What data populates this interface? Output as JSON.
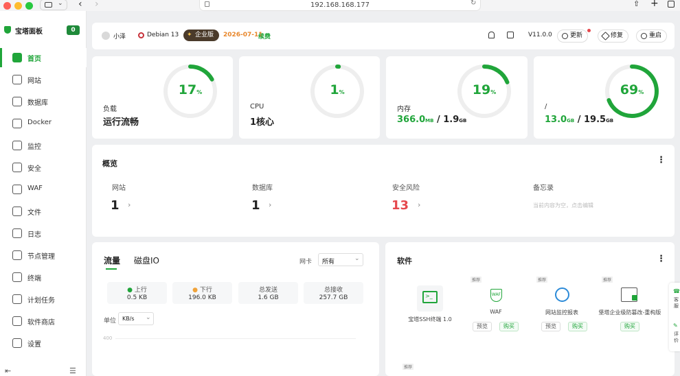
{
  "browser": {
    "url": "192.168.168.177"
  },
  "sidebar": {
    "title": "宝塔面板",
    "badge": "0",
    "items": [
      {
        "label": "首页",
        "icon": "home-icon"
      },
      {
        "label": "网站",
        "icon": "website-icon"
      },
      {
        "label": "数据库",
        "icon": "database-icon"
      },
      {
        "label": "Docker",
        "icon": "docker-icon"
      },
      {
        "label": "监控",
        "icon": "monitor-icon"
      },
      {
        "label": "安全",
        "icon": "shield-icon"
      },
      {
        "label": "WAF",
        "icon": "waf-icon"
      },
      {
        "label": "文件",
        "icon": "folder-icon"
      },
      {
        "label": "日志",
        "icon": "log-icon"
      },
      {
        "label": "节点管理",
        "icon": "node-icon"
      },
      {
        "label": "终端",
        "icon": "terminal-icon"
      },
      {
        "label": "计划任务",
        "icon": "calendar-icon"
      },
      {
        "label": "软件商店",
        "icon": "store-icon"
      },
      {
        "label": "设置",
        "icon": "gear-icon"
      }
    ]
  },
  "header": {
    "user": "小泽",
    "os": "Debian 13",
    "edition": "企业版",
    "expiry": "2026-07-11",
    "renew": "续费",
    "version": "V11.0.0",
    "update": "更新",
    "repair": "修复",
    "restart": "重启"
  },
  "stats": [
    {
      "name": "负载",
      "value": "运行流畅",
      "percent": 17
    },
    {
      "name": "CPU",
      "value": "1核心",
      "percent": 1
    },
    {
      "name": "内存",
      "used": "366.0",
      "used_unit": "MB",
      "sep": " / ",
      "total": "1.9",
      "total_unit": "GB",
      "percent": 19
    },
    {
      "name": "/",
      "used": "13.0",
      "used_unit": "GB",
      "sep": " / ",
      "total": "19.5",
      "total_unit": "GB",
      "percent": 69
    }
  ],
  "overview": {
    "title": "概览",
    "items": [
      {
        "label": "网站",
        "value": "1"
      },
      {
        "label": "数据库",
        "value": "1"
      },
      {
        "label": "安全风险",
        "value": "13"
      },
      {
        "label": "备忘录",
        "note": "当前内容为空，点击编辑"
      }
    ]
  },
  "traffic": {
    "tab_flow": "流量",
    "tab_io": "磁盘IO",
    "nic_label": "网卡",
    "nic_value": "所有",
    "boxes": [
      {
        "label": "上行",
        "value": "0.5 KB"
      },
      {
        "label": "下行",
        "value": "196.0 KB"
      },
      {
        "label": "总发送",
        "value": "1.6 GB"
      },
      {
        "label": "总接收",
        "value": "257.7 GB"
      }
    ],
    "unit_label": "单位",
    "unit_value": "KB/s",
    "y_tick": "400"
  },
  "software": {
    "title": "软件",
    "items": [
      {
        "name": "宝塔SSH终端 1.0"
      },
      {
        "name": "WAF",
        "tag": "推荐",
        "preview": "预览",
        "buy": "购买"
      },
      {
        "name": "网站监控报表",
        "tag": "推荐",
        "preview": "预览",
        "buy": "购买"
      },
      {
        "name": "堡塔企业级防篡改-重构版",
        "tag": "推荐",
        "buy": "购买"
      }
    ],
    "tag5": "推荐"
  },
  "float": {
    "a": "客服",
    "b": "评价"
  }
}
